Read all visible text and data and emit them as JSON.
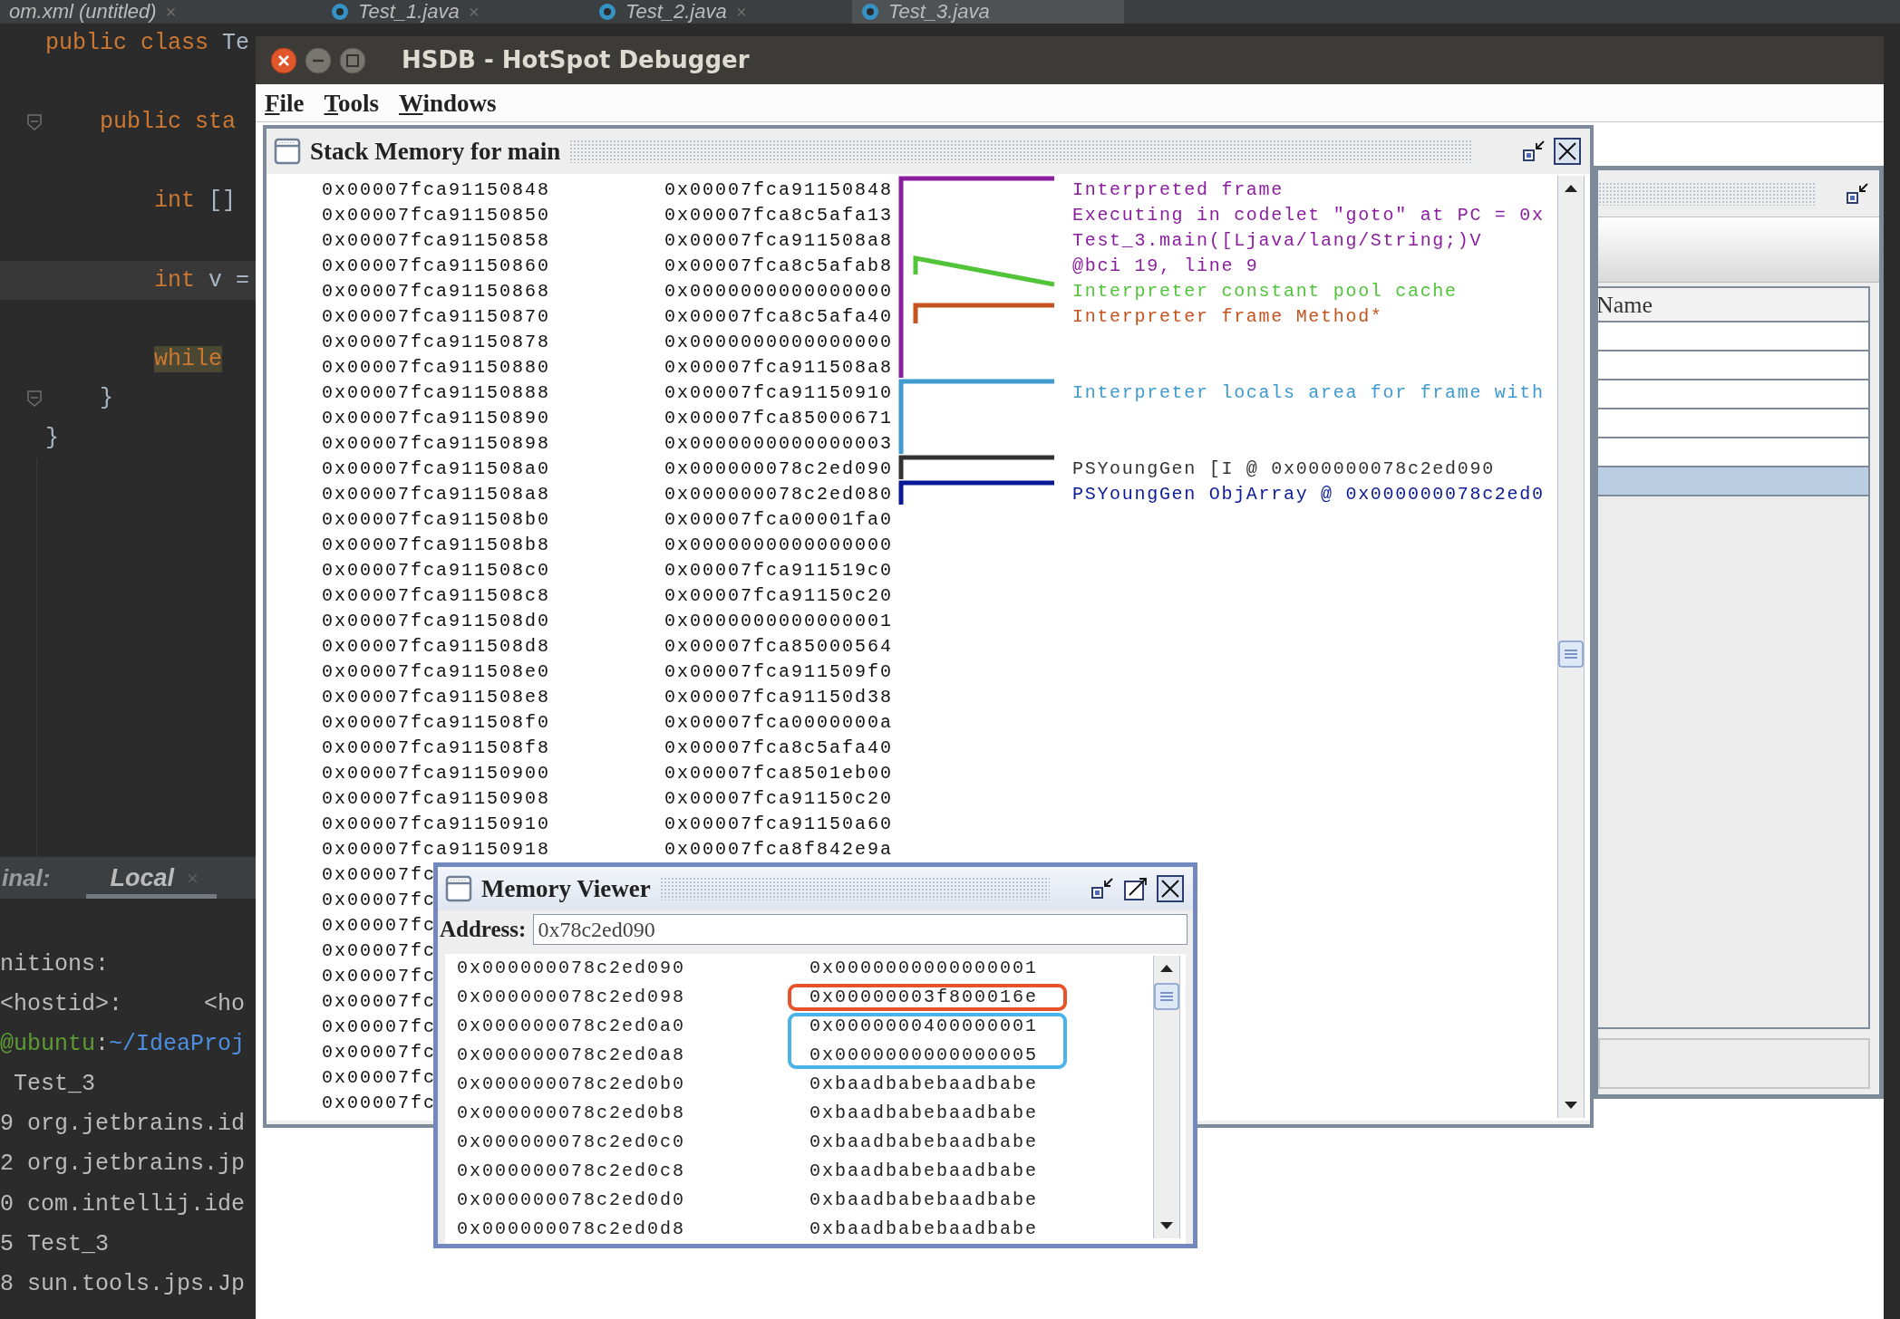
{
  "ide": {
    "editor_tabs": [
      {
        "label": "om.xml (untitled)",
        "close": "×",
        "selected": false
      },
      {
        "label": "Test_1.java",
        "close": "×",
        "selected": false
      },
      {
        "label": "Test_2.java",
        "close": "×",
        "selected": false
      },
      {
        "label": "Test_3.java",
        "selected": true
      }
    ],
    "code_lines": [
      {
        "current": false,
        "tokens": [
          {
            "text": "public class ",
            "kind": "keyword"
          },
          {
            "text": "Te",
            "kind": "plain"
          }
        ]
      },
      {
        "current": false
      },
      {
        "current": false,
        "tokens": [
          {
            "text": "    public sta",
            "kind": "keyword"
          }
        ]
      },
      {
        "current": false
      },
      {
        "current": false,
        "tokens": [
          {
            "text": "        int ",
            "kind": "keyword"
          },
          {
            "text": "[]",
            "kind": "plain"
          }
        ]
      },
      {
        "current": false
      },
      {
        "current": true,
        "tokens": [
          {
            "text": "        int ",
            "kind": "keyword"
          },
          {
            "text": "v =",
            "kind": "plain"
          }
        ]
      },
      {
        "current": false
      },
      {
        "current": false,
        "tokens": [
          {
            "text": "        while",
            "kind": "match"
          }
        ]
      },
      {
        "current": false,
        "tokens": [
          {
            "text": "    }",
            "kind": "plain"
          }
        ]
      },
      {
        "current": false,
        "tokens": [
          {
            "text": "}",
            "kind": "plain"
          }
        ]
      }
    ],
    "terminal": {
      "label": "inal:",
      "tabs": [
        {
          "label": "Local",
          "close": "×",
          "selected": true
        }
      ],
      "lines": [
        [
          {
            "text": "nitions:",
            "kind": "plain"
          }
        ],
        [
          {
            "text": "<hostid>:      <ho",
            "kind": "plain"
          }
        ],
        [
          {
            "text": "@ubuntu",
            "kind": "host"
          },
          {
            "text": ":",
            "kind": "plain"
          },
          {
            "text": "~/IdeaProj",
            "kind": "path"
          }
        ],
        [
          {
            "text": " Test_3",
            "kind": "plain"
          }
        ],
        [
          {
            "text": "9 org.jetbrains.id",
            "kind": "plain"
          }
        ],
        [
          {
            "text": "2 org.jetbrains.jp",
            "kind": "plain"
          }
        ],
        [
          {
            "text": "0 com.intellij.ide",
            "kind": "plain"
          }
        ],
        [
          {
            "text": "5 Test_3",
            "kind": "plain"
          }
        ],
        [
          {
            "text": "8 sun.tools.jps.Jp",
            "kind": "plain"
          }
        ]
      ]
    }
  },
  "hsdb": {
    "title": "HSDB - HotSpot Debugger",
    "menu": [
      "File",
      "Tools",
      "Windows"
    ],
    "stack_memory": {
      "title": "Stack Memory for main",
      "rows": [
        {
          "address": "0x00007fca91150848",
          "value": "0x00007fca91150848"
        },
        {
          "address": "0x00007fca91150850",
          "value": "0x00007fca8c5afa13"
        },
        {
          "address": "0x00007fca91150858",
          "value": "0x00007fca911508a8"
        },
        {
          "address": "0x00007fca91150860",
          "value": "0x00007fca8c5afab8"
        },
        {
          "address": "0x00007fca91150868",
          "value": "0x0000000000000000"
        },
        {
          "address": "0x00007fca91150870",
          "value": "0x00007fca8c5afa40"
        },
        {
          "address": "0x00007fca91150878",
          "value": "0x0000000000000000"
        },
        {
          "address": "0x00007fca91150880",
          "value": "0x00007fca911508a8"
        },
        {
          "address": "0x00007fca91150888",
          "value": "0x00007fca91150910"
        },
        {
          "address": "0x00007fca91150890",
          "value": "0x00007fca85000671"
        },
        {
          "address": "0x00007fca91150898",
          "value": "0x0000000000000003"
        },
        {
          "address": "0x00007fca911508a0",
          "value": "0x000000078c2ed090"
        },
        {
          "address": "0x00007fca911508a8",
          "value": "0x000000078c2ed080"
        },
        {
          "address": "0x00007fca911508b0",
          "value": "0x00007fca00001fa0"
        },
        {
          "address": "0x00007fca911508b8",
          "value": "0x0000000000000000"
        },
        {
          "address": "0x00007fca911508c0",
          "value": "0x00007fca911519c0"
        },
        {
          "address": "0x00007fca911508c8",
          "value": "0x00007fca91150c20"
        },
        {
          "address": "0x00007fca911508d0",
          "value": "0x0000000000000001"
        },
        {
          "address": "0x00007fca911508d8",
          "value": "0x00007fca85000564"
        },
        {
          "address": "0x00007fca911508e0",
          "value": "0x00007fca911509f0"
        },
        {
          "address": "0x00007fca911508e8",
          "value": "0x00007fca91150d38"
        },
        {
          "address": "0x00007fca911508f0",
          "value": "0x00007fca0000000a"
        },
        {
          "address": "0x00007fca911508f8",
          "value": "0x00007fca8c5afa40"
        },
        {
          "address": "0x00007fca91150900",
          "value": "0x00007fca8501eb00"
        },
        {
          "address": "0x00007fca91150908",
          "value": "0x00007fca91150c20"
        },
        {
          "address": "0x00007fca91150910",
          "value": "0x00007fca91150a60"
        },
        {
          "address": "0x00007fca91150918",
          "value": "0x00007fca8f842e9a"
        },
        {
          "address": "0x00007fc"
        },
        {
          "address": "0x00007fc"
        },
        {
          "address": "0x00007fc"
        },
        {
          "address": "0x00007fc"
        },
        {
          "address": "0x00007fc"
        },
        {
          "address": "0x00007fc"
        },
        {
          "address": "0x00007fc"
        },
        {
          "address": "0x00007fc"
        },
        {
          "address": "0x00007fc"
        },
        {
          "address": "0x00007fc"
        }
      ],
      "annotations": [
        {
          "kind": "bracket",
          "color": "#8a1e9e",
          "lines": [
            "Interpreted frame",
            "Executing in codelet \"goto\" at PC = 0x",
            "Test_3.main([Ljava/lang/String;)V",
            "@bci 19, line 9"
          ]
        },
        {
          "kind": "slanted",
          "color": "#52c43a",
          "lines": [
            "Interpreter constant pool cache"
          ]
        },
        {
          "kind": "inset",
          "color": "#c4531f",
          "lines": [
            "Interpreter frame Method*"
          ]
        },
        {
          "kind": "bracket",
          "color": "#3f9ad0",
          "lines": [
            "Interpreter locals area for frame with"
          ]
        },
        {
          "kind": "bracket",
          "color": "#333333",
          "lines": [
            "PSYoungGen [I @ 0x000000078c2ed090"
          ]
        },
        {
          "kind": "bracket",
          "color": "#0a1a96",
          "lines": [
            "PSYoungGen ObjArray @ 0x000000078c2ed0"
          ]
        }
      ]
    },
    "threads": {
      "column": "Name",
      "rows": [
        {
          "selected": false
        },
        {
          "selected": false
        },
        {
          "selected": false
        },
        {
          "selected": false
        },
        {
          "selected": false
        },
        {
          "selected": true
        }
      ]
    },
    "memory_viewer": {
      "title": "Memory Viewer",
      "address_label": "Address:",
      "address_value": "0x78c2ed090",
      "rows": [
        {
          "address": "0x000000078c2ed090",
          "value": "0x0000000000000001"
        },
        {
          "address": "0x000000078c2ed098",
          "value": "0x00000003f800016e"
        },
        {
          "address": "0x000000078c2ed0a0",
          "value": "0x0000000400000001"
        },
        {
          "address": "0x000000078c2ed0a8",
          "value": "0x0000000000000005"
        },
        {
          "address": "0x000000078c2ed0b0",
          "value": "0xbaadbabebaadbabe"
        },
        {
          "address": "0x000000078c2ed0b8",
          "value": "0xbaadbabebaadbabe"
        },
        {
          "address": "0x000000078c2ed0c0",
          "value": "0xbaadbabebaadbabe"
        },
        {
          "address": "0x000000078c2ed0c8",
          "value": "0xbaadbabebaadbabe"
        },
        {
          "address": "0x000000078c2ed0d0",
          "value": "0xbaadbabebaadbabe"
        },
        {
          "address": "0x000000078c2ed0d8",
          "value": "0xbaadbabebaadbabe"
        }
      ],
      "boxes": [
        {
          "color": "#e8532a"
        },
        {
          "color": "#4ab4ea"
        }
      ]
    }
  }
}
